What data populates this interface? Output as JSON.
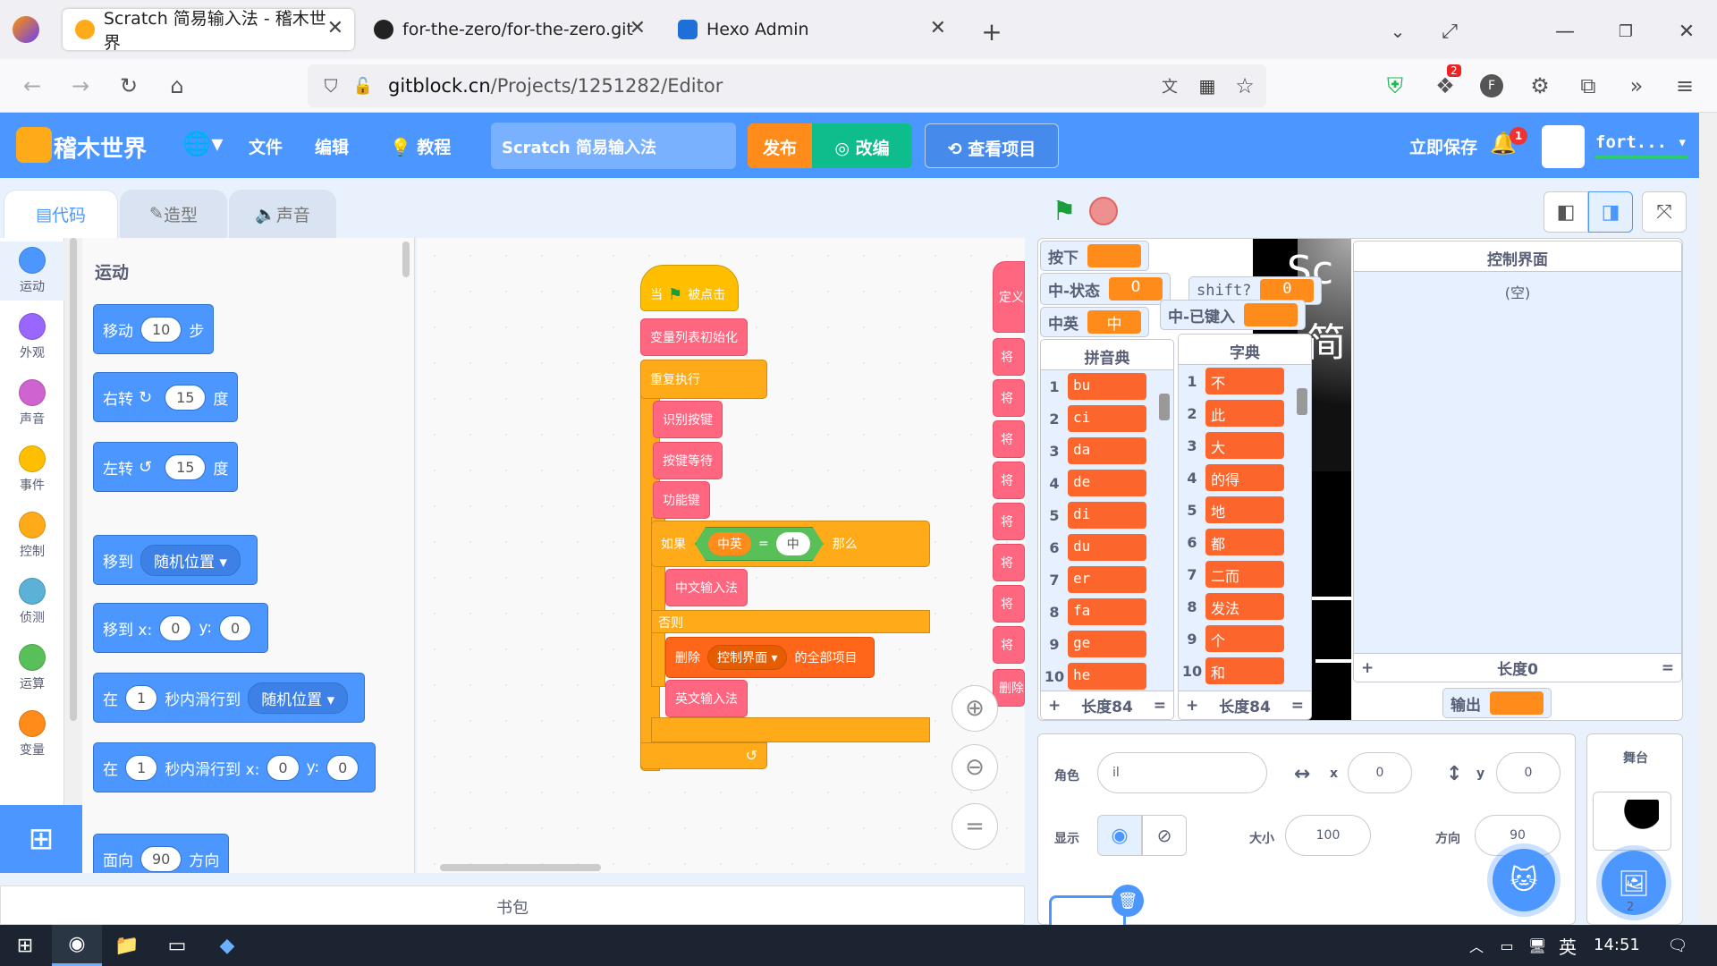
{
  "browser": {
    "tabs": [
      {
        "title": "Scratch 简易输入法 - 稽木世界",
        "active": true
      },
      {
        "title": "for-the-zero/for-the-zero.git",
        "active": false
      },
      {
        "title": "Hexo Admin",
        "active": false
      }
    ],
    "url_host": "gitblock.cn",
    "url_path": "/Projects/1251282/Editor",
    "ext_badge": "2",
    "profile_letter": "F"
  },
  "menubar": {
    "brand": "稽木世界",
    "file": "文件",
    "edit": "编辑",
    "tutorials": "教程",
    "project_title": "Scratch 简易输入法",
    "publish": "发布",
    "remix": "改编",
    "see_project": "查看项目",
    "save_now": "立即保存",
    "notif_count": "1",
    "username": "fort..."
  },
  "editor_tabs": {
    "code": "代码",
    "costumes": "造型",
    "sounds": "声音"
  },
  "categories": [
    {
      "label": "运动",
      "color": "#4c97ff"
    },
    {
      "label": "外观",
      "color": "#9966ff"
    },
    {
      "label": "声音",
      "color": "#cf63cf"
    },
    {
      "label": "事件",
      "color": "#ffbf00"
    },
    {
      "label": "控制",
      "color": "#ffab19"
    },
    {
      "label": "侦测",
      "color": "#5cb1d6"
    },
    {
      "label": "运算",
      "color": "#59c059"
    },
    {
      "label": "变量",
      "color": "#ff8c1a"
    }
  ],
  "palette": {
    "heading": "运动",
    "move": {
      "a": "移动",
      "n": "10",
      "b": "步"
    },
    "turn_right": {
      "a": "右转",
      "n": "15",
      "b": "度"
    },
    "turn_left": {
      "a": "左转",
      "n": "15",
      "b": "度"
    },
    "goto": {
      "a": "移到",
      "d": "随机位置"
    },
    "goto_xy": {
      "a": "移到 x:",
      "x": "0",
      "b": "y:",
      "y": "0"
    },
    "glide": {
      "a": "在",
      "n": "1",
      "b": "秒内滑行到",
      "d": "随机位置"
    },
    "glide_xy": {
      "a": "在",
      "n": "1",
      "b": "秒内滑行到 x:",
      "x": "0",
      "c": "y:",
      "y": "0"
    },
    "point": {
      "a": "面向",
      "n": "90",
      "b": "方向"
    }
  },
  "script": {
    "hat_when": "当",
    "hat_clicked": "被点击",
    "init": "变量列表初始化",
    "forever": "重复执行",
    "detect": "识别按键",
    "wait": "按键等待",
    "func": "功能键",
    "if": "如果",
    "cond_var": "中英",
    "cond_eq": "=",
    "cond_val": "中",
    "then": "那么",
    "cn_ime": "中文输入法",
    "else": "否则",
    "delete": "删除",
    "delete_list": "控制界面",
    "delete_all": "的全部项目",
    "en_ime": "英文输入法",
    "def_label": "定义",
    "side_label": "将",
    "side_delete": "删除"
  },
  "stage": {
    "mon_press": {
      "label": "按下",
      "value": ""
    },
    "mon_state": {
      "label": "中-状态",
      "value": "0"
    },
    "mon_shift": {
      "label": "shift?",
      "value": "0"
    },
    "mon_cnen": {
      "label": "中英",
      "value": "中"
    },
    "mon_typed": {
      "label": "中-已键入",
      "value": ""
    },
    "mon_output": {
      "label": "输出",
      "value": ""
    },
    "pinyin_list": {
      "title": "拼音典",
      "items": [
        "bu",
        "ci",
        "da",
        "de",
        "di",
        "du",
        "er",
        "fa",
        "ge",
        "he"
      ],
      "length": "长度84"
    },
    "dict_list": {
      "title": "字典",
      "items": [
        "不",
        "此",
        "大",
        "的得",
        "地",
        "都",
        "二而",
        "发法",
        "个",
        "和"
      ],
      "length": "长度84"
    },
    "control_list": {
      "title": "控制界面",
      "empty": "(空)",
      "length": "长度0"
    },
    "overlay_text_1": "Sc",
    "overlay_text_2": "简"
  },
  "sprite": {
    "label_sprite": "角色",
    "name": "il",
    "label_x": "x",
    "x": "0",
    "label_y": "y",
    "y": "0",
    "label_show": "显示",
    "label_size": "大小",
    "size": "100",
    "label_dir": "方向",
    "direction": "90"
  },
  "stage_panel": {
    "title": "舞台",
    "backdrops": "2"
  },
  "backpack": "书包",
  "taskbar": {
    "ime": "英",
    "time": "14:51"
  }
}
